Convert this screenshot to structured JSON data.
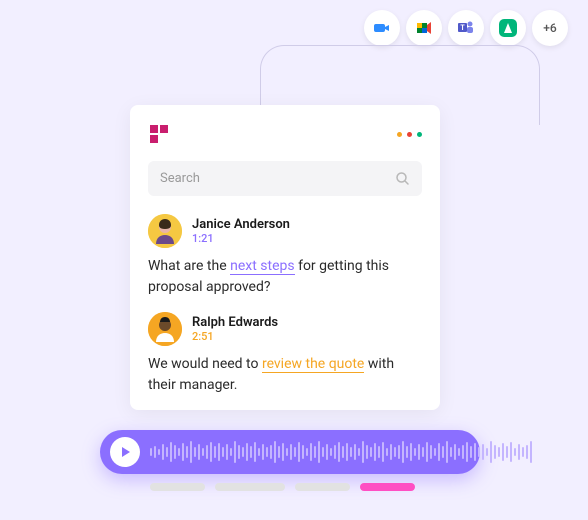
{
  "integrations": {
    "items": [
      "zoom",
      "google-meet",
      "ms-teams",
      "app-green"
    ],
    "more_label": "+6"
  },
  "card": {
    "search_placeholder": "Search",
    "messages": [
      {
        "name": "Janice Anderson",
        "time": "1:21",
        "time_color": "#8b6fff",
        "body_pre": "What are the ",
        "highlight": "next steps",
        "highlight_class": "hl-purple",
        "body_post": " for getting this proposal approved?"
      },
      {
        "name": "Ralph Edwards",
        "time": "2:51",
        "time_color": "#f5a623",
        "body_pre": "We would need to ",
        "highlight": "review the quote",
        "highlight_class": "hl-orange",
        "body_post": " with their manager."
      }
    ]
  }
}
